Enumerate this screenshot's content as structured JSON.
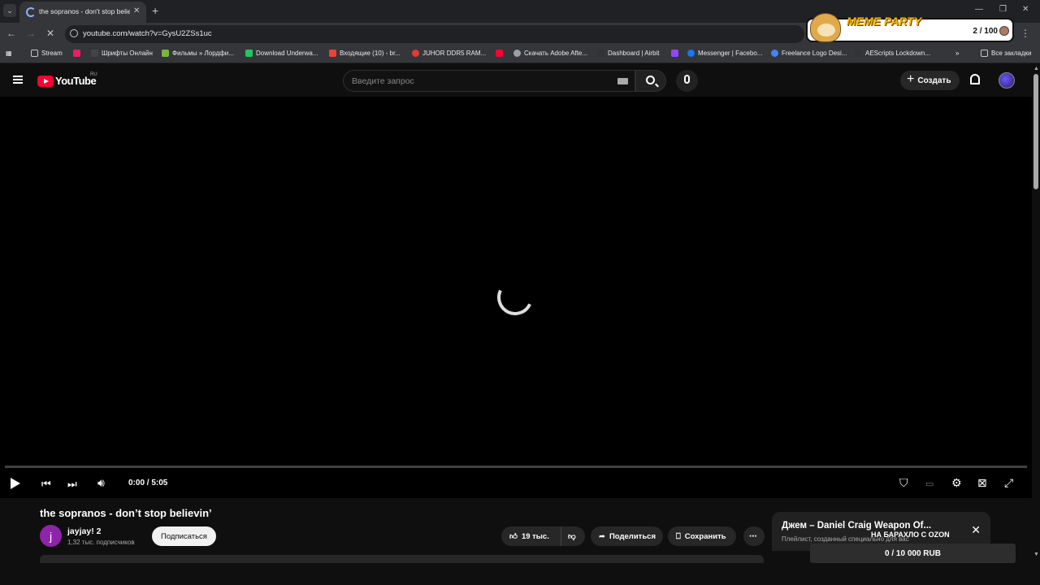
{
  "browser": {
    "tab_title": "the sopranos - don't stop believin'",
    "url": "youtube.com/watch?v=GysU2ZSs1uc",
    "bookmarks": [
      {
        "label": "Stream",
        "color": "#c4c7c5"
      },
      {
        "label": "",
        "color": "#e91e63"
      },
      {
        "label": "Шрифты Онлайн",
        "color": "#444"
      },
      {
        "label": "Фильмы » Лордфи...",
        "color": "#7cb342"
      },
      {
        "label": "Download Underwa...",
        "color": "#22c55e"
      },
      {
        "label": "Входящие (10) - br...",
        "color": "#ea4335"
      },
      {
        "label": "JUHOR DDR5 RAM...",
        "color": "#e53935"
      },
      {
        "label": "",
        "color": "#ff0033"
      },
      {
        "label": "Скачать Adobe Afte...",
        "color": "#9aa0a6"
      },
      {
        "label": "Dashboard | Airbit",
        "color": "#333"
      },
      {
        "label": "",
        "color": "#9146ff"
      },
      {
        "label": "Messenger | Facebo...",
        "color": "#1877f2"
      },
      {
        "label": "Freelance Logo Desi...",
        "color": "#4285f4"
      },
      {
        "label": "AEScripts Lockdown...",
        "color": "#333"
      }
    ],
    "bookmarks_more": "»",
    "all_bookmarks": "Все закладки"
  },
  "meme_party": {
    "title": "MEME PARTY",
    "count": "2 / 100"
  },
  "youtube": {
    "logo_text": "YouTube",
    "region": "RU",
    "search_placeholder": "Введите запрос",
    "create_label": "Создать"
  },
  "player": {
    "time": "0:00 / 5:05",
    "progress_fraction": 0
  },
  "video": {
    "title": "the sopranos - don’t stop believin’",
    "channel_initial": "j",
    "channel_name": "jayjay! 2",
    "subscribers": "1,32 тыс. подписчиков",
    "subscribe_label": "Подписаться",
    "likes": "19 тыс.",
    "share_label": "Поделиться",
    "save_label": "Сохранить"
  },
  "playlist_card": {
    "title": "Джем – Daniel Craig Weapon Of...",
    "subtitle": "Плейлист, созданный специально для вас"
  },
  "ozon": {
    "label": "НА БАРАХЛО С OZON",
    "progress": "0 / 10 000 RUB"
  }
}
